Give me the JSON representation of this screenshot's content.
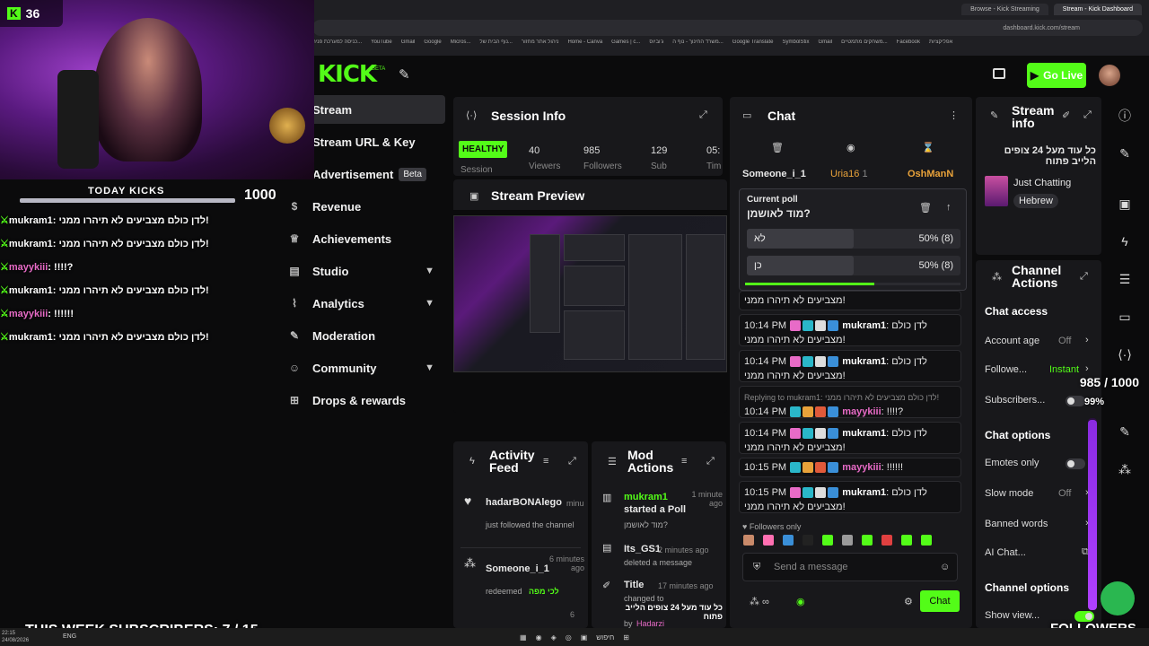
{
  "browser": {
    "tabs": [
      "Browse - Kick Streaming",
      "Stream - Kick Dashboard"
    ],
    "url": "dashboard.kick.com/stream",
    "bookmarks": [
      "כניסה למערכת פניה...",
      "YouTube",
      "Gmail",
      "Google",
      "Micros...",
      "נוף הבית של...",
      "ניהול אתר מחזור",
      "Home - Canva",
      "Games | c...",
      "ג'וביוס",
      "משרד החינוך - נוף ה...",
      "Google Translate",
      "SymbolStix",
      "Gmail",
      "משחקים מתמטיים...",
      "Facebook",
      "אפליקציות"
    ]
  },
  "topbar": {
    "logo": "KICK",
    "logo_beta": "BETA",
    "go_live": "Go Live"
  },
  "sidebar": {
    "items": [
      {
        "label": "Stream",
        "icon": "stream-icon"
      },
      {
        "label": "Stream URL & Key",
        "icon": "key-icon"
      },
      {
        "label": "Advertisement",
        "icon": "ad-icon",
        "badge": "Beta"
      },
      {
        "label": "Revenue",
        "icon": "dollar-icon"
      },
      {
        "label": "Achievements",
        "icon": "trophy-icon"
      },
      {
        "label": "Studio",
        "icon": "studio-icon"
      },
      {
        "label": "Analytics",
        "icon": "analytics-icon"
      },
      {
        "label": "Moderation",
        "icon": "wrench-icon"
      },
      {
        "label": "Community",
        "icon": "community-icon"
      },
      {
        "label": "Drops & rewards",
        "icon": "gift-icon"
      }
    ]
  },
  "session": {
    "title": "Session Info",
    "health": "HEALTHY",
    "health_sub": "Session",
    "viewers": "40",
    "viewers_label": "Viewers",
    "followers": "985",
    "followers_label": "Followers",
    "subs": "129",
    "subs_label": "Sub",
    "time": "05:",
    "time_label": "Tim"
  },
  "preview": {
    "title": "Stream Preview"
  },
  "activity": {
    "title": "Activity Feed",
    "items": [
      {
        "user": "hadarBONAlego",
        "meta": "minu",
        "text": "just followed the channel"
      },
      {
        "user": "Someone_i_1",
        "meta": "6 minutes ago",
        "text": "redeemed",
        "reward": "לכי מפה"
      }
    ],
    "next_meta": "6"
  },
  "mod": {
    "title": "Mod Actions",
    "items": [
      {
        "user": "mukram1",
        "action": "started a Poll",
        "time": "1 minute ago",
        "detail": "מוד לאושמן?"
      },
      {
        "user": "Its_GS1",
        "time": "2 minutes ago",
        "action": "deleted a message"
      },
      {
        "user": "Title",
        "time": "17 minutes ago",
        "action": "changed to",
        "detail": "כל עוד מעל 24 צופים הלייב פתוח",
        "by": "by",
        "by_user": "Hadarzi"
      }
    ]
  },
  "chat": {
    "title": "Chat",
    "top_users": [
      "Someone_i_1",
      "Uria16",
      "OshManN"
    ],
    "top_counts": [
      "",
      "1",
      ""
    ],
    "poll": {
      "label": "Current poll",
      "question": "מוד לאושמן?",
      "options": [
        {
          "label": "לא",
          "result": "50% (8)",
          "pct": 50
        },
        {
          "label": "כן",
          "result": "50% (8)",
          "pct": 50
        }
      ],
      "progress": 0.6
    },
    "partial_top": "מצביעים לא תיהרו ממני!",
    "messages": [
      {
        "time": "10:14 PM",
        "user": "mukram1",
        "color": "#ffffff",
        "text": "לדן כולם",
        "text2": "מצביעים לא תיהרו ממני!"
      },
      {
        "time": "10:14 PM",
        "user": "mukram1",
        "color": "#ffffff",
        "text": "לדן כולם",
        "text2": "מצביעים לא תיהרו ממני!"
      },
      {
        "time": "10:14 PM",
        "user": "mayykiii",
        "color": "#e86bc7",
        "text": "!!!!?",
        "reply": "Replying to mukram1: לדן כולם מצביעים לא תיהרו ממני!"
      },
      {
        "time": "10:14 PM",
        "user": "mukram1",
        "color": "#ffffff",
        "text": "לדן כולם",
        "text2": "מצביעים לא תיהרו ממני!"
      },
      {
        "time": "10:15 PM",
        "user": "mayykiii",
        "color": "#e86bc7",
        "text": "!!!!!!"
      },
      {
        "time": "10:15 PM",
        "user": "mukram1",
        "color": "#ffffff",
        "text": "לדן כולם",
        "text2": "מצביעים לא תיהרו ממני!"
      }
    ],
    "followers_only": "Followers only",
    "input_placeholder": "Send a message",
    "send": "Chat"
  },
  "stream_info": {
    "title": "Stream info",
    "stream_title": "כל עוד מעל 24 צופים הלייב פתוח",
    "category": "Just Chatting",
    "tag": "Hebrew"
  },
  "channel_actions": {
    "title": "Channel Actions",
    "chat_access": "Chat access",
    "rows1": [
      {
        "label": "Account age",
        "value": "Off"
      },
      {
        "label": "Followe...",
        "value": "Instant"
      },
      {
        "label": "Subscribers..."
      }
    ],
    "chat_options": "Chat options",
    "rows2": [
      {
        "label": "Emotes only"
      },
      {
        "label": "Slow mode",
        "value": "Off"
      },
      {
        "label": "Banned words"
      },
      {
        "label": "AI Chat..."
      }
    ],
    "channel_options": "Channel options",
    "show_view": "Show view..."
  },
  "overlay": {
    "kicks": "36",
    "today_kicks": "TODAY KICKS",
    "today_value": "1000",
    "chat": [
      {
        "user": "mukram1",
        "text": "לדן כולם מצביעים לא תיהרו ממני!",
        "pink": false
      },
      {
        "user": "mukram1",
        "text": "לדן כולם מצביעים לא תיהרו ממני!",
        "pink": false
      },
      {
        "user": "mayykiii",
        "text": "!!!!?",
        "pink": true
      },
      {
        "user": "mukram1",
        "text": "לדן כולם מצביעים לא תיהרו ממני!",
        "pink": false
      },
      {
        "user": "mayykiii",
        "text": "!!!!!!",
        "pink": true
      },
      {
        "user": "mukram1",
        "text": "לדן כולם מצביעים לא תיהרו ממני!",
        "pink": false
      }
    ],
    "subs_goal": "THIS WEEK SUBSCRIBERS: 7 / 15",
    "followers_goal": "985 / 1000",
    "followers_pct": "99%",
    "followers_label": "FOLLOWERS"
  },
  "taskbar": {
    "time": "22:15",
    "date": "24/08/2026",
    "lang": "ENG",
    "search": "חיפוש"
  },
  "colors": {
    "accent": "#53fc18",
    "panel": "#18181b",
    "bg": "#0b0b0c",
    "pink": "#e86bc7"
  }
}
